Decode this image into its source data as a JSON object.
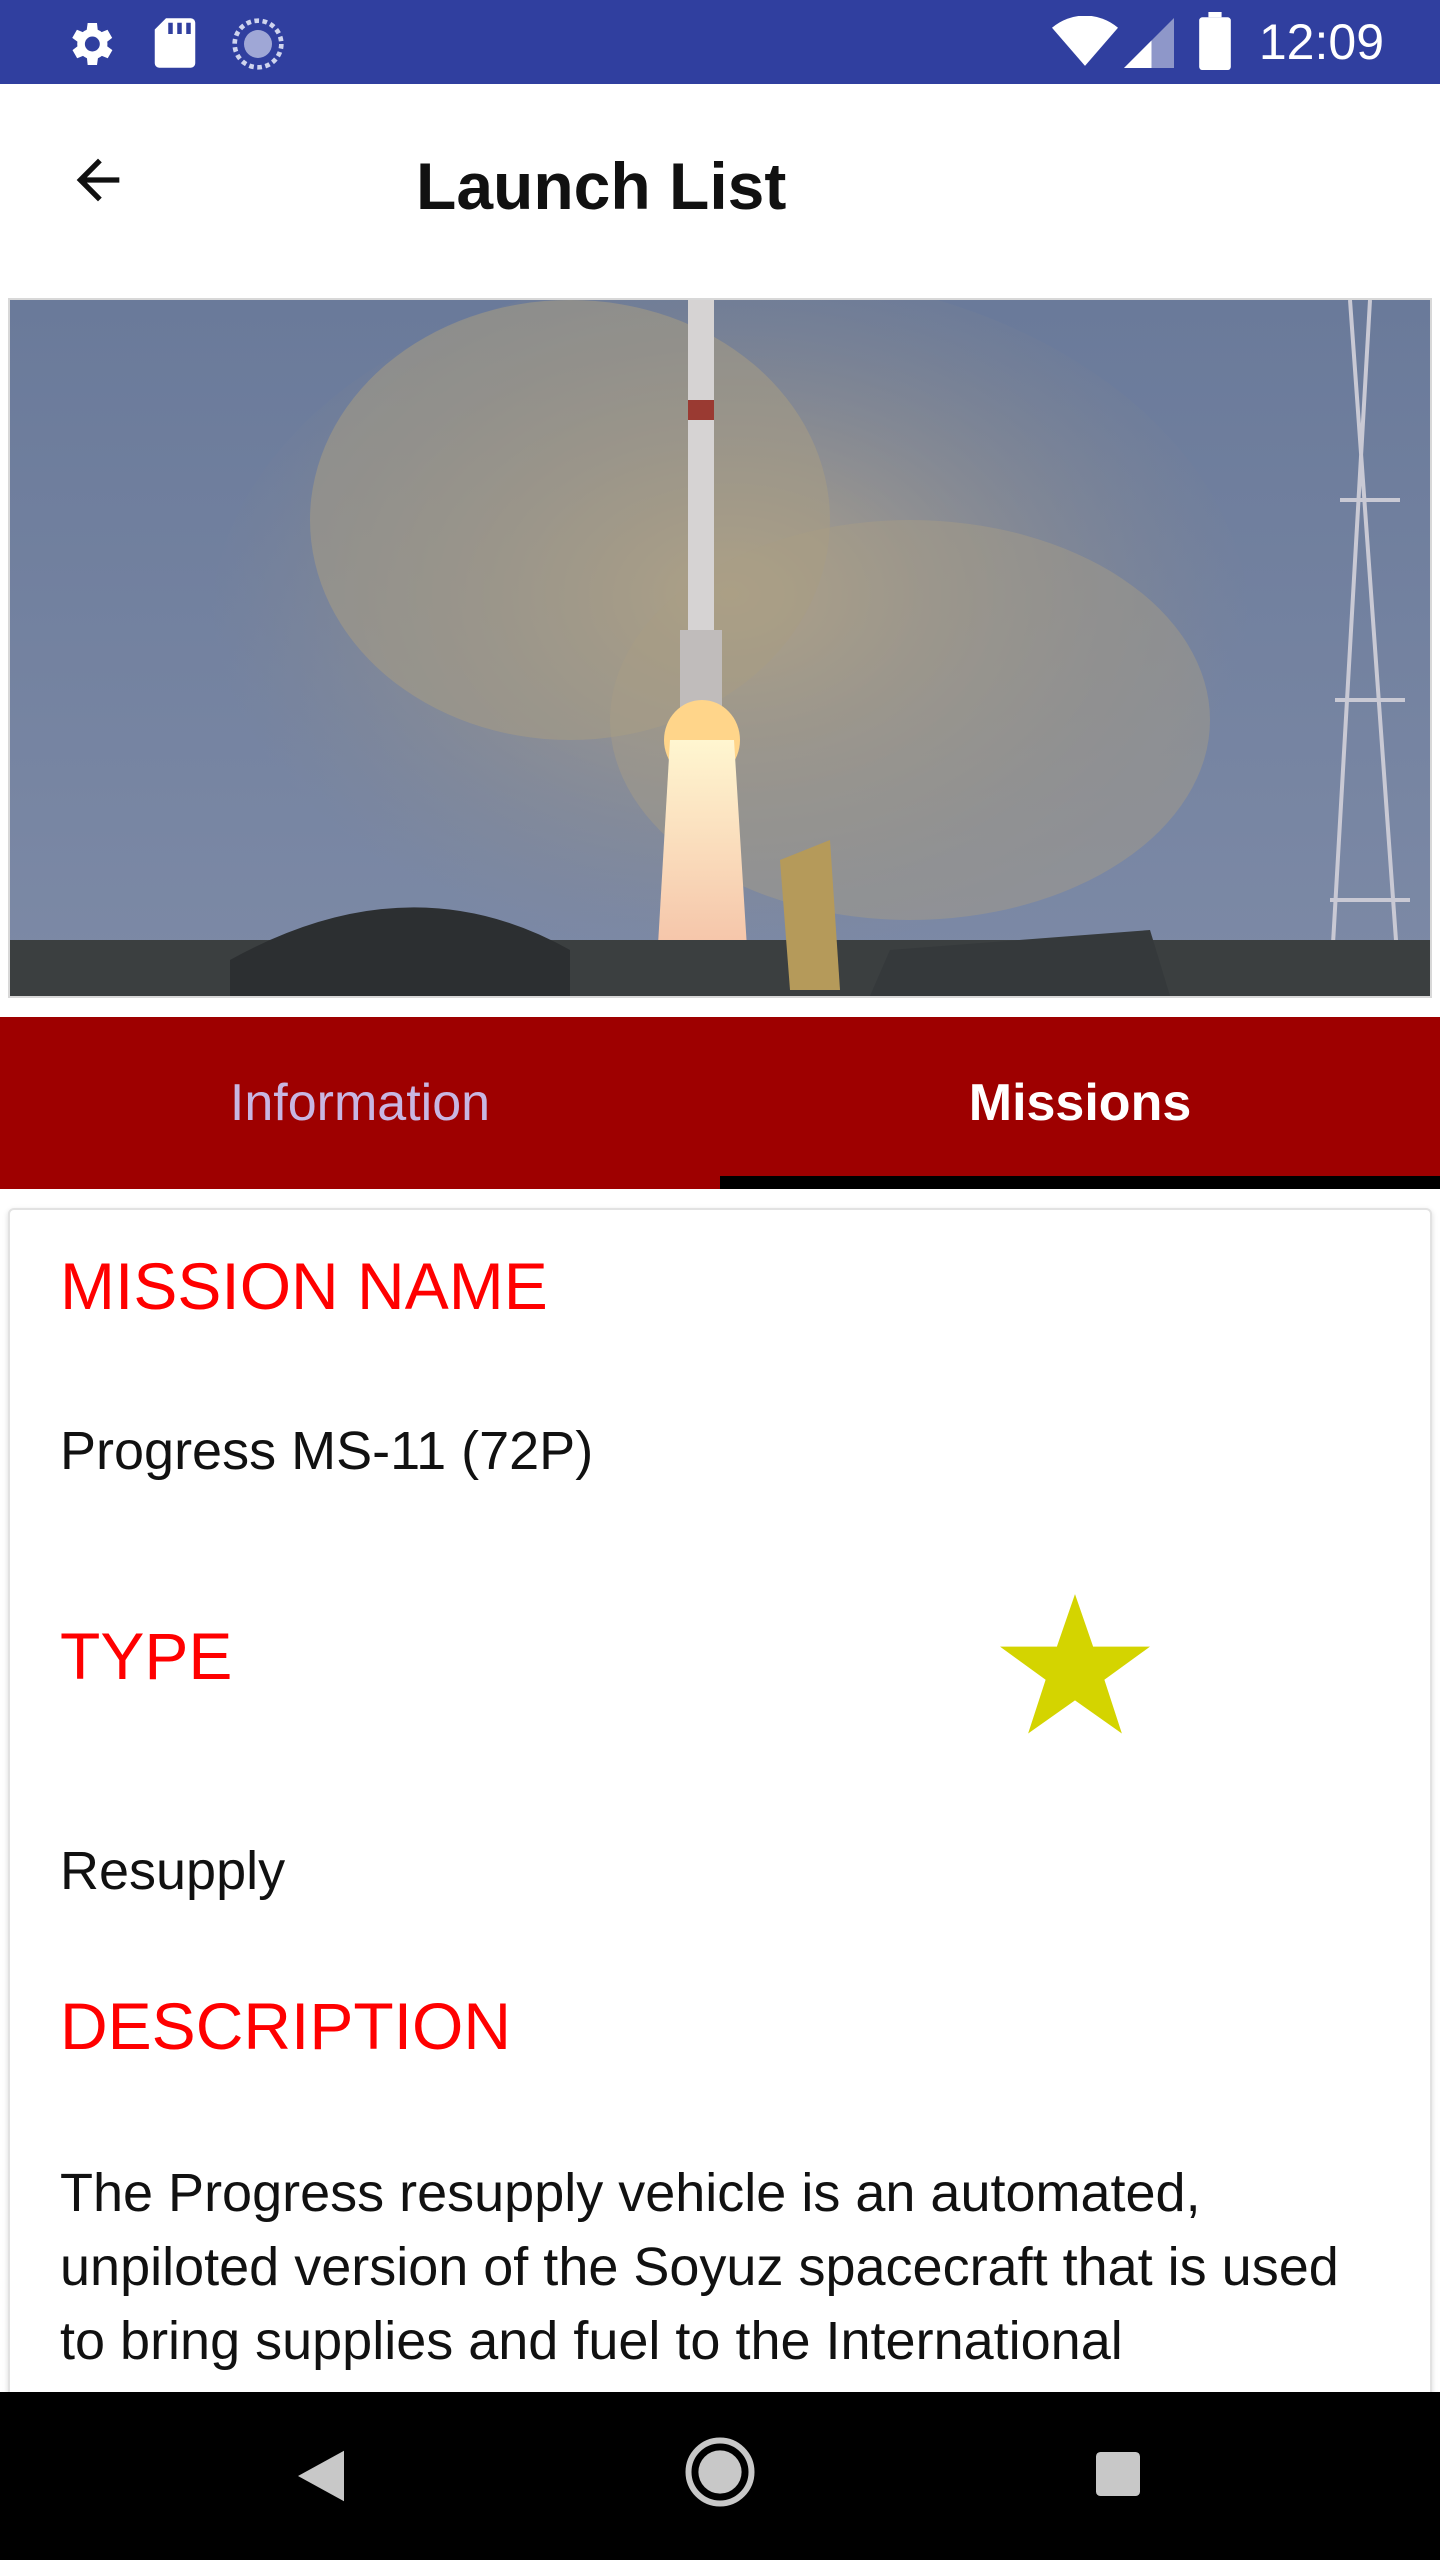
{
  "status_bar": {
    "time": "12:09",
    "icons": [
      "settings-icon",
      "sd-card-icon",
      "sync-icon",
      "wifi-icon",
      "cell-signal-icon",
      "battery-icon"
    ]
  },
  "app_bar": {
    "title": "Launch List",
    "back_icon": "arrow-back-icon"
  },
  "hero": {
    "image": "rocket-launch-photo"
  },
  "tabs": [
    {
      "label": "Information",
      "selected": false
    },
    {
      "label": "Missions",
      "selected": true
    }
  ],
  "mission": {
    "name_label": "MISSION NAME",
    "name": "Progress MS-11 (72P)",
    "type_label": "TYPE",
    "type": "Resupply",
    "description_label": "DESCRIPTION",
    "description": "The Progress resupply vehicle is an automated, unpiloted version of the Soyuz spacecraft that is used to bring supplies and fuel to the International",
    "favorite_icon": "star-icon"
  },
  "nav_bar": {
    "icons": [
      "back-triangle-icon",
      "home-circle-icon",
      "recents-square-icon"
    ]
  },
  "colors": {
    "status_bar": "#303F9F",
    "tab_bar": "#9E0000",
    "label_red": "#FF0000",
    "star": "#D4D400",
    "tab_inactive": "#c8b6e2"
  }
}
